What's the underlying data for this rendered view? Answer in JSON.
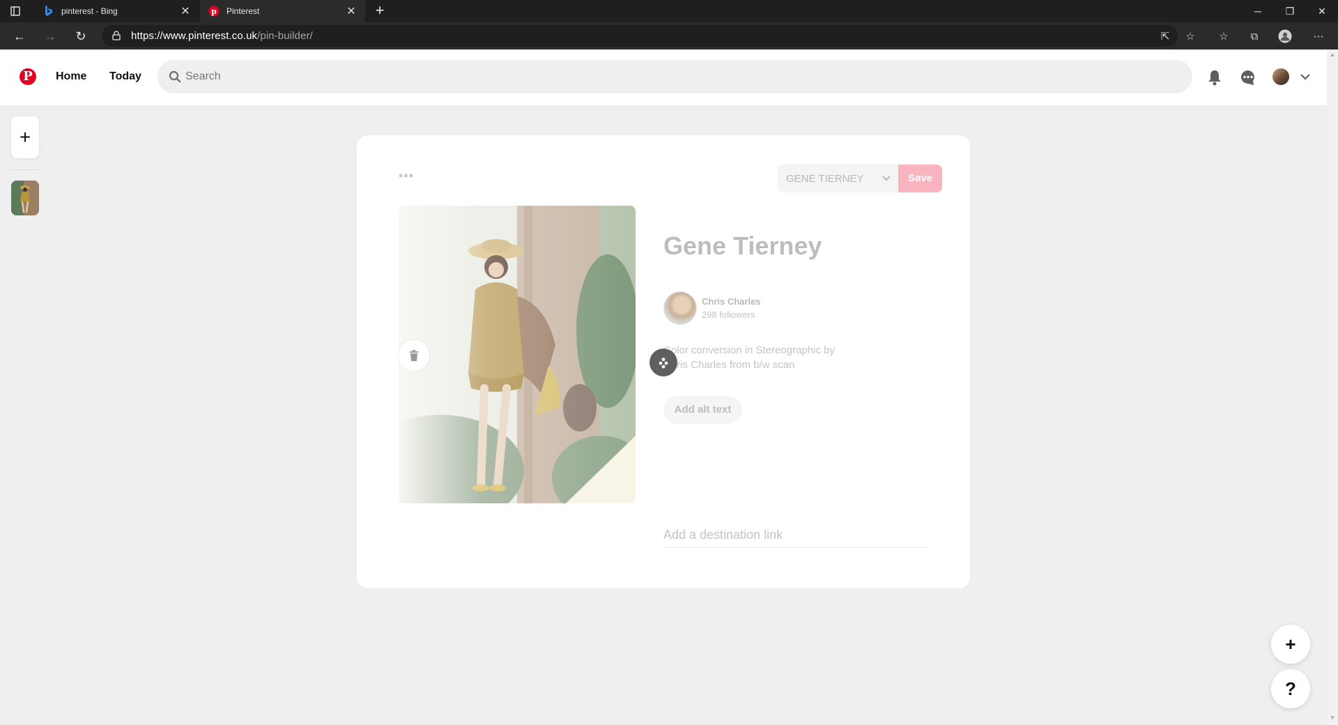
{
  "browser": {
    "tabs": [
      {
        "label": "pinterest - Bing",
        "icon": "bing-icon",
        "active": false
      },
      {
        "label": "Pinterest",
        "icon": "pinterest-icon",
        "active": true
      }
    ],
    "url_domain": "https://www.pinterest.co.uk",
    "url_path": "/pin-builder/"
  },
  "header": {
    "logo": "P",
    "nav": [
      {
        "label": "Home"
      },
      {
        "label": "Today"
      }
    ],
    "search_placeholder": "Search"
  },
  "pin": {
    "more": "•••",
    "board": "GENE TIERNEY",
    "save_label": "Save",
    "title": "Gene Tierney",
    "creator": {
      "name": "Chris Charles",
      "followers": "298 followers"
    },
    "description": "Color conversion in Stereographic by Chris Charles from b/w scan",
    "alt_text_label": "Add alt text",
    "link_placeholder": "Add a destination link"
  },
  "rail": {
    "create": "+"
  },
  "fab": {
    "create": "+",
    "help": "?"
  },
  "colors": {
    "brand": "#e60023",
    "save_disabled": "#f8b4bf"
  }
}
